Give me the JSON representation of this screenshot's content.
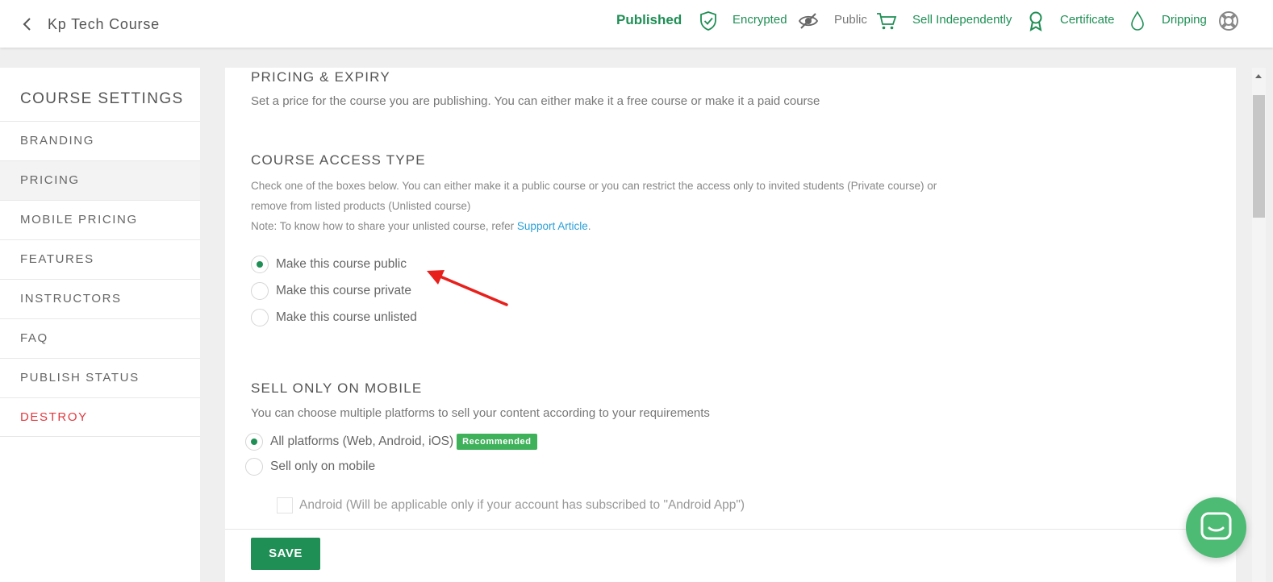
{
  "header": {
    "course_title": "Kp Tech Course",
    "statuses": {
      "published": "Published",
      "encrypted": "Encrypted",
      "public": "Public",
      "sell_independently": "Sell Independently",
      "certificate": "Certificate",
      "dripping": "Dripping"
    },
    "icons": [
      "back-chevron-icon",
      "shield-check-icon",
      "eye-slash-icon",
      "cart-icon",
      "award-ribbon-icon",
      "water-drop-icon",
      "lifebuoy-icon"
    ]
  },
  "sidebar": {
    "title": "COURSE SETTINGS",
    "items": [
      {
        "label": "BRANDING"
      },
      {
        "label": "PRICING",
        "active": true
      },
      {
        "label": "MOBILE PRICING"
      },
      {
        "label": "FEATURES"
      },
      {
        "label": "INSTRUCTORS"
      },
      {
        "label": "FAQ"
      },
      {
        "label": "PUBLISH STATUS"
      },
      {
        "label": "DESTROY"
      }
    ]
  },
  "main": {
    "pricing": {
      "title": "PRICING & EXPIRY",
      "description": "Set a price for the course you are publishing. You can either make it a free course or make it a paid course"
    },
    "access": {
      "title": "COURSE ACCESS TYPE",
      "line1": "Check one of the boxes below. You can either make it a public course or you can restrict the access only to invited students (Private course) or",
      "line2": "remove from listed products (Unlisted course)",
      "note_prefix": "Note: To know how to share your unlisted course, refer ",
      "note_link": "Support Article",
      "note_suffix": ".",
      "options": [
        {
          "label": "Make this course public",
          "selected": true
        },
        {
          "label": "Make this course private",
          "selected": false
        },
        {
          "label": "Make this course unlisted",
          "selected": false
        }
      ]
    },
    "mobile": {
      "title": "SELL ONLY ON MOBILE",
      "description": "You can choose multiple platforms to sell your content according to your requirements",
      "options": [
        {
          "label": "All platforms (Web, Android, iOS)",
          "badge": "Recommended",
          "selected": true
        },
        {
          "label": "Sell only on mobile",
          "selected": false
        }
      ],
      "android_label": "Android (Will be applicable only if your account has subscribed to \"Android App\")"
    },
    "save_label": "SAVE"
  },
  "colors": {
    "accent_green": "#1f8f55",
    "badge_green": "#3fb15b",
    "danger_red": "#e0383e",
    "link_blue": "#2a9fd8",
    "annotation_red": "#e8201c",
    "chat_green": "#4dbb74"
  }
}
